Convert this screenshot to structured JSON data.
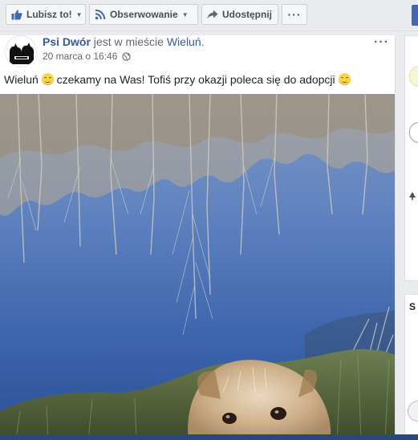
{
  "actions": {
    "like_label": "Lubisz to!",
    "follow_label": "Obserwowanie",
    "share_label": "Udostępnij",
    "more_label": "···"
  },
  "post": {
    "author": "Psi Dwór",
    "checkin_text": " jest w mieście ",
    "place": "Wieluń",
    "place_suffix": ".",
    "timestamp": "20 marca o 16:46",
    "menu_label": "···",
    "text_part1": "Wieluń ",
    "text_part2": " czekamy na Was! Tofiś przy okazji poleca się do adopcji ",
    "photo_alt": "Zdjęcie: pies nad stawem"
  },
  "sidebar": {
    "card2_letter": "S"
  },
  "colors": {
    "link": "#385898",
    "brand": "#4267b2",
    "page_bg": "#e9ebee",
    "meta_text": "#616770"
  },
  "icons": {
    "like": "thumbs-up-icon",
    "follow": "rss-icon",
    "share": "share-arrow-icon",
    "privacy": "globe-icon",
    "emoji": "smiling-face-emoji"
  }
}
